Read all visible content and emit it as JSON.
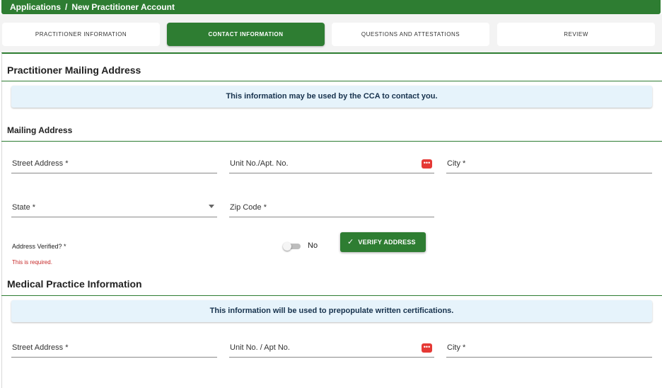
{
  "breadcrumb": {
    "root": "Applications",
    "separator": "/",
    "current": "New Practitioner Account"
  },
  "steps": [
    {
      "label": "PRACTITIONER INFORMATION",
      "active": false
    },
    {
      "label": "CONTACT INFORMATION",
      "active": true
    },
    {
      "label": "QUESTIONS AND ATTESTATIONS",
      "active": false
    },
    {
      "label": "REVIEW",
      "active": false
    }
  ],
  "mailing": {
    "section_title": "Practitioner Mailing Address",
    "banner": "This information may be used by the CCA to contact you.",
    "subheading": "Mailing Address",
    "street_label": "Street Address *",
    "unit_label": "Unit No./Apt. No.",
    "city_label": "City *",
    "state_label": "State *",
    "zip_label": "Zip Code *",
    "address_verified_label": "Address Verified?  *",
    "verified_value": "No",
    "error": "This is required.",
    "verify_button": "VERIFY ADDRESS"
  },
  "practice": {
    "section_title": "Medical Practice Information",
    "banner": "This information will be used to prepopulate written certifications.",
    "street_label": "Street Address *",
    "unit_label": "Unit No. / Apt No.",
    "city_label": "City *"
  },
  "icons": {
    "autofill": "password-dots-icon",
    "state_dropdown": "caret-down-icon",
    "verify": "check-icon"
  },
  "colors": {
    "primary_green": "#2e7d32",
    "banner_bg": "#e6f3fb",
    "error_red": "#c62828",
    "autofill_icon": "#e53935"
  }
}
